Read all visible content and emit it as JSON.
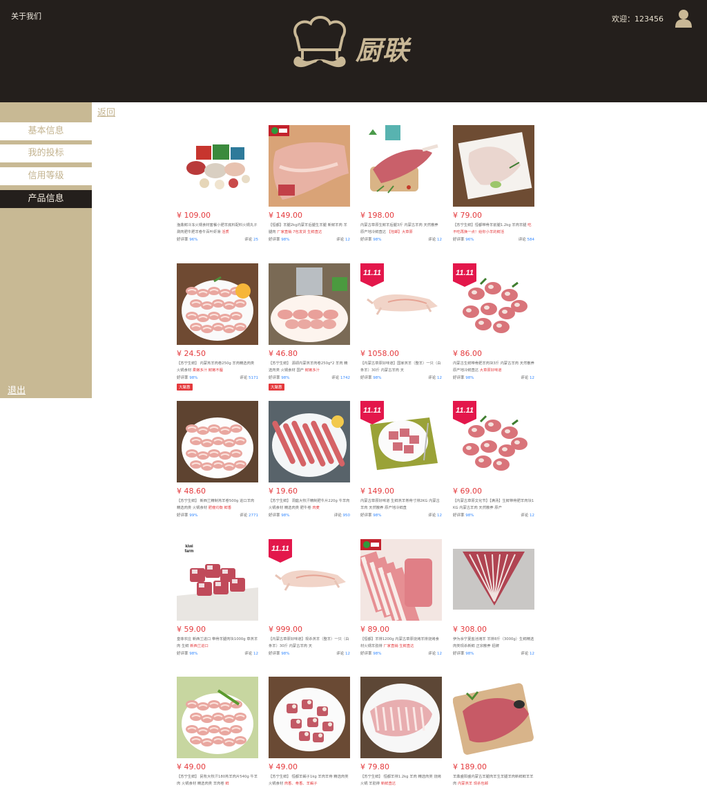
{
  "header": {
    "about_label": "关于我们",
    "brand_text": "厨联",
    "welcome_text": "欢迎：123456"
  },
  "sidebar": {
    "items": [
      {
        "label": "基本信息"
      },
      {
        "label": "我的投标"
      },
      {
        "label": "信用等级"
      },
      {
        "label": "产品信息"
      }
    ],
    "logout_label": "退出"
  },
  "back_label": "返回",
  "rating_label": "好评率",
  "review_label": "评论",
  "products": [
    {
      "price": "¥ 109.00",
      "desc": "渔鼎鲜冷冻火锅食材套餐小肥羊底料配料火锅丸子涮肉肥牛肥羊卷牛百叶虾滑 ",
      "desc_hl": "活质",
      "rating": "96%",
      "reviews": "25",
      "image": "hotpot-set",
      "badge": ""
    },
    {
      "price": "¥ 149.00",
      "desc": "【恒都】羊腿2kg内蒙羊后腿生羊腿 新鲜羊肉 羊腿肉 ",
      "desc_hl": "厂家直销 7包发货 生鲜直达",
      "rating": "98%",
      "reviews": "12",
      "image": "lamb-leg-board",
      "badge": "hengdu"
    },
    {
      "price": "¥ 198.00",
      "desc": "内蒙古草原生鲜羊后腿3斤 内蒙古羊肉 天然散养 原产地冷鲜直达 ",
      "desc_hl": "【包邮】大草原",
      "rating": "98%",
      "reviews": "12",
      "image": "lamb-leg-herbs",
      "badge": "brand"
    },
    {
      "price": "¥ 79.00",
      "desc": "【苏宁生鲜】恒都带骨羊前腿1.2kg 羊肉羊腿 ",
      "desc_hl": "吃不吃再换一点！给你小羊的鲜活",
      "rating": "96%",
      "reviews": "584",
      "image": "lamb-leg-plate",
      "badge": ""
    },
    {
      "price": "¥ 24.50",
      "desc": "【苏宁生鲜】 内蒙羔羊肉卷250g 羊肉精选肉类 火锅食材 ",
      "desc_hl": "柔嫩多汁 鲜嫩不膻",
      "rating": "98%",
      "reviews": "5171",
      "image": "rolls-lemon",
      "badge": "",
      "promo": "大聚惠"
    },
    {
      "price": "¥ 46.80",
      "desc": "【苏宁生鲜】 源颂内蒙羔羊肉卷250g*2 羊肉 精选肉类 火锅食材 国产 ",
      "desc_hl": "鲜嫩多汁",
      "rating": "98%",
      "reviews": "1742",
      "image": "rolls-hotpot",
      "badge": "",
      "promo": "大聚惠"
    },
    {
      "price": "¥ 1058.00",
      "desc": "【内蒙古草原好味道】国家羔羊（整羊）一只（白条羊）30斤 内蒙古羊肉 天",
      "desc_hl": "",
      "rating": "98%",
      "reviews": "12",
      "image": "whole-lamb",
      "badge": "1111"
    },
    {
      "price": "¥ 86.00",
      "desc": "内蒙古生鲜带骨肥羊肉块3斤 内蒙古羊肉 天然散养 原产地冷鲜直达 ",
      "desc_hl": "大草原好味道",
      "rating": "98%",
      "reviews": "12",
      "image": "chops",
      "badge": "1111"
    },
    {
      "price": "¥ 48.60",
      "desc": "【苏宁生鲜】 新西兰精制羔羊卷500g 进口羊肉 精选肉类 火锅食材 ",
      "desc_hl": "肥瘦均衡 鲜香",
      "rating": "99%",
      "reviews": "2771",
      "image": "rolls-white",
      "badge": ""
    },
    {
      "price": "¥ 19.60",
      "desc": "【苏宁生鲜】 洞庭大牧汗精制肥牛片220g 牛羊肉 火锅食材 精选肉类 肥牛卷 ",
      "desc_hl": "肉麦",
      "rating": "98%",
      "reviews": "950",
      "image": "beef-rolls",
      "badge": ""
    },
    {
      "price": "¥ 149.00",
      "desc": "内蒙古草原好味道 生鲜羔羊脊骨寸排2KG 内蒙古羊肉 天然散养 原产地冷鲜直",
      "desc_hl": "",
      "rating": "98%",
      "reviews": "12",
      "image": "cubes-plate",
      "badge": "1111"
    },
    {
      "price": "¥ 69.00",
      "desc": "【内蒙古草原文化节】【满汤】生鲜带骨肥羊肉块1KG 内蒙古羊肉 天然散养 原产",
      "desc_hl": "",
      "rating": "98%",
      "reviews": "12",
      "image": "chops",
      "badge": "1111"
    },
    {
      "price": "¥ 59.00",
      "desc": "皇菲农庄 新西兰进口 带骨羊腿肉块1000g 草羔羊肉 生鲜 ",
      "desc_hl": "新西兰进口",
      "rating": "98%",
      "reviews": "12",
      "image": "meat-cubes",
      "badge": "kiwi"
    },
    {
      "price": "¥ 999.00",
      "desc": "【内蒙古草原好味道】现杀羔羊（整羊）一只（白条羊）30斤 内蒙古羊肉 天",
      "desc_hl": "",
      "rating": "98%",
      "reviews": "12",
      "image": "whole-lamb",
      "badge": "1111"
    },
    {
      "price": "¥ 89.00",
      "desc": "【恒都】羊排1200g 内蒙古草原烧烤羊排烧烤食材火锅羊肋排 ",
      "desc_hl": "厂家直销 生鲜直达",
      "rating": "98%",
      "reviews": "12",
      "image": "ribs-white",
      "badge": "hengdu"
    },
    {
      "price": "¥ 308.00",
      "desc": "伊为余宁夏盐池滩羊 羊排8斤（3000g）生鲜精选肉类现杀新鲜 正宗散养 招牌",
      "desc_hl": "",
      "rating": "98%",
      "reviews": "12",
      "image": "rack-grey",
      "badge": ""
    },
    {
      "price": "¥ 49.00",
      "desc": "【苏宁生鲜】 民牧大牧汗180羔羊肉片540g 牛羊肉 火锅食材 精选肉类 羊肉卷 ",
      "desc_hl": "鲜",
      "rating": "",
      "reviews": "",
      "image": "rolls-celery",
      "badge": ""
    },
    {
      "price": "¥ 49.00",
      "desc": "【苏宁生鲜】 恒都羊蝎子1kg 羊肉羊骨 精选肉类 火锅食材 ",
      "desc_hl": "肉香、骨香、羊蝎子",
      "rating": "",
      "reviews": "",
      "image": "bones-plate",
      "badge": ""
    },
    {
      "price": "¥ 79.80",
      "desc": "【苏宁生鲜】 恒都羊排1.2kg 羊肉 精选肉类 烧烤火锅 羊肋排 ",
      "desc_hl": "新鲜直达",
      "rating": "",
      "reviews": "",
      "image": "rack-plate",
      "badge": ""
    },
    {
      "price": "¥ 189.00",
      "desc": "羊鼎盛阳盛内蒙古羊腿肉羊生羊腿羊肉新鲜鲜羊羊肉 ",
      "desc_hl": "内蒙羔羊 现杀包邮",
      "rating": "",
      "reviews": "",
      "image": "leg-board",
      "badge": ""
    }
  ],
  "colors": {
    "header_bg": "#241f1c",
    "brand_gold": "#c9b896",
    "sidebar_bg": "#c8b994",
    "price_red": "#e4393c",
    "link_blue": "#3388ff"
  }
}
